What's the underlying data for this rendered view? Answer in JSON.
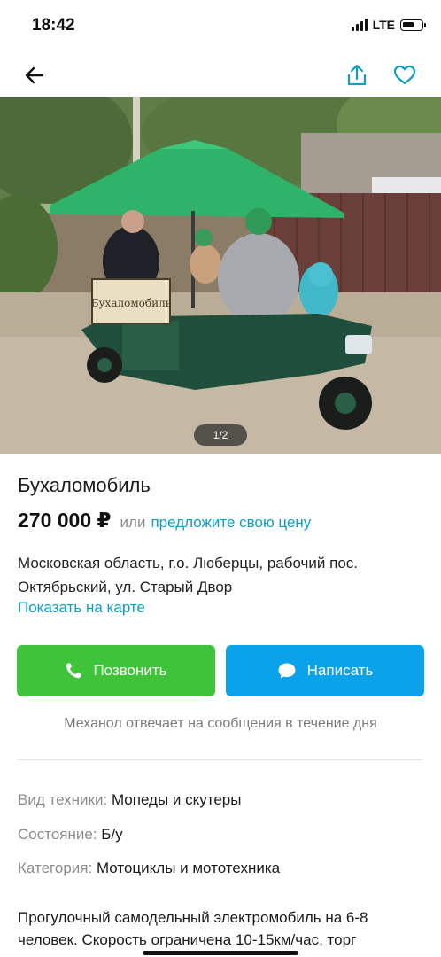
{
  "status_bar": {
    "time": "18:42",
    "network": "LTE"
  },
  "photo": {
    "counter": "1/2",
    "sign_text": "Бухаломобиль"
  },
  "listing": {
    "title": "Бухаломобиль",
    "price": "270 000 ₽",
    "price_or": "или",
    "price_offer": "предложите свою цену",
    "address_line1": "Московская область, г.о. Люберцы, рабочий пос.",
    "address_line2": "Октябрьский, ул. Старый Двор",
    "map_link": "Показать на карте"
  },
  "actions": {
    "call_label": "Позвонить",
    "message_label": "Написать"
  },
  "seller_note": "Механол отвечает на сообщения в течение дня",
  "specs": [
    {
      "key": "Вид техники:",
      "value": "Мопеды и скутеры"
    },
    {
      "key": "Состояние:",
      "value": "Б/у"
    },
    {
      "key": "Категория:",
      "value": "Мотоциклы и мототехника"
    }
  ],
  "description": {
    "line1": "Прогулочный самодельный электромобиль на 6-8",
    "line2": "человек. Скорость ограничена 10-15км/час, торг"
  },
  "colors": {
    "accent_link": "#0d9ec4",
    "call_green": "#3fc33a",
    "message_blue": "#0aa2e8"
  }
}
